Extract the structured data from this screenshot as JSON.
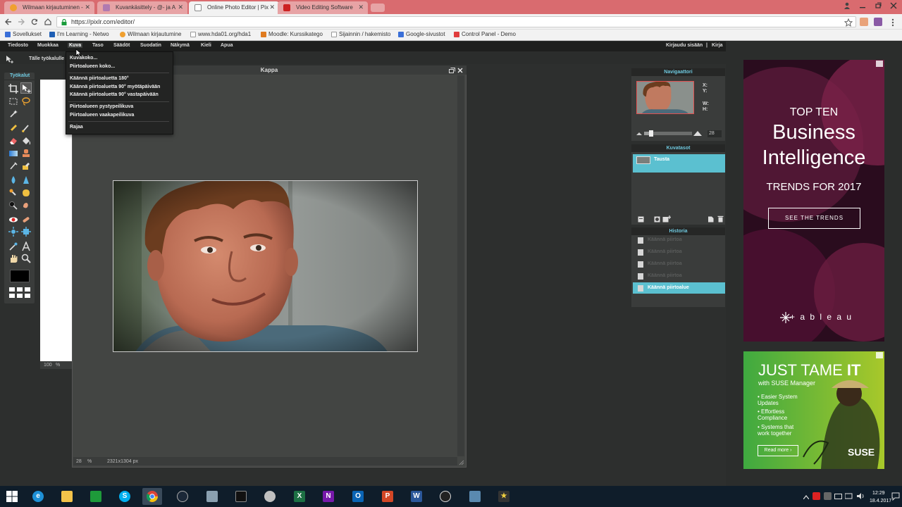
{
  "browser": {
    "tabs": [
      {
        "title": "Wilmaan kirjautuminen -",
        "icon": "wilma-icon",
        "color": "#f0a030"
      },
      {
        "title": "Kuvankäsittely - @- ja A",
        "icon": "mail-icon",
        "color": "#b07ab0"
      },
      {
        "title": "Online Photo Editor | Pix",
        "icon": "page-icon",
        "color": "#ffffff"
      },
      {
        "title": "Video Editing Software",
        "icon": "video-icon",
        "color": "#cc2222"
      }
    ],
    "url": "https://pixlr.com/editor/",
    "bookmarks": [
      "Sovellukset",
      "I'm Learning - Netwo",
      "Wilmaan kirjautumine",
      "www.hda01.org/hda1",
      "Moodle: Kurssikatego",
      "Sijainnin / hakemisto",
      "Google-sivustot",
      "Control Panel - Demo"
    ],
    "close_glyph": "✕"
  },
  "pixlr": {
    "menus": [
      "Tiedosto",
      "Muokkaa",
      "Kuva",
      "Taso",
      "Säädöt",
      "Suodatin",
      "Näkymä",
      "Kieli",
      "Apua"
    ],
    "active_menu": "Kuva",
    "login": "Kirjaudu sisään",
    "login_sep": "|",
    "register": "Kirja",
    "option_label": "Tälle työkalulle",
    "toolbox_title": "Työkalut",
    "dropdown": {
      "group1": [
        "Kuvakoko...",
        "Piirtoalueen koko..."
      ],
      "group2": [
        "Käännä piirtoaluetta 180°",
        "Käännä piirtoaluetta 90° myötäpäivään",
        "Käännä piirtoaluetta 90° vastapäivään"
      ],
      "group3": [
        "Piirtoalueen pystypeilikuva",
        "Piirtoalueen vaakapeilikuva"
      ],
      "group4": [
        "Rajaa"
      ]
    },
    "document": {
      "title": "Kappa",
      "zoom": "28",
      "zoom_unit": "%",
      "size": "2321x1304 px",
      "small_zoom": "100",
      "small_unit": "%"
    },
    "navigator": {
      "title": "Navigaattori",
      "x": "X:",
      "y": "Y:",
      "w": "W:",
      "h": "H:",
      "zoom": "28",
      "zoom_fraction": 0.12
    },
    "layers": {
      "title": "Kuvatasot",
      "items": [
        "Tausta"
      ]
    },
    "history": {
      "title": "Historia",
      "items": [
        "Käännä piirtoa",
        "Käännä piirtoa",
        "Käännä piirtoa",
        "Käännä piirtoa",
        "Käännä piirtoalue"
      ],
      "active_index": 4
    }
  },
  "ads": {
    "tableau": {
      "line1": "TOP TEN",
      "line2": "Business",
      "line3": "Intelligence",
      "line4": "TRENDS FOR 2017",
      "cta": "SEE THE TRENDS",
      "brand": "+ a b l e a u"
    },
    "suse": {
      "title_a": "JUST TAME ",
      "title_b": "IT",
      "subtitle": "with SUSE Manager",
      "bullets": [
        "Easier System Updates",
        "Effortless Compliance",
        "Systems that work together"
      ],
      "cta": "Read more ›",
      "brand": "SUSE"
    }
  },
  "taskbar": {
    "time": "12:29",
    "date": "18.4.2017"
  }
}
